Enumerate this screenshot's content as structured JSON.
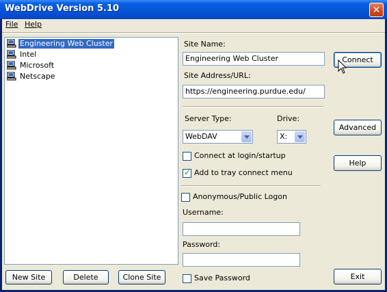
{
  "window": {
    "title": "WebDrive Version 5.10",
    "close_glyph": "✕"
  },
  "menu": {
    "file_label": "File",
    "help_label": "Help"
  },
  "sites": [
    {
      "label": "Engineering Web Cluster",
      "selected": true
    },
    {
      "label": "Intel"
    },
    {
      "label": "Microsoft"
    },
    {
      "label": "Netscape"
    }
  ],
  "list_buttons": {
    "new_site": "New Site",
    "delete": "Delete",
    "clone_site": "Clone Site"
  },
  "form": {
    "site_name_label": "Site Name:",
    "site_name_value": "Engineering Web Cluster",
    "site_address_label": "Site Address/URL:",
    "site_address_value": "https://engineering.purdue.edu/",
    "server_type_label": "Server Type:",
    "server_type_value": "WebDAV",
    "drive_label": "Drive:",
    "drive_value": "X:",
    "connect_at_login_label": "Connect at login/startup",
    "connect_at_login_checked": false,
    "add_to_tray_label": "Add to tray connect menu",
    "add_to_tray_checked": true,
    "anonymous_label": "Anonymous/Public Logon",
    "anonymous_checked": false,
    "username_label": "Username:",
    "username_value": "",
    "password_label": "Password:",
    "password_value": "",
    "save_password_label": "Save Password",
    "save_password_checked": false
  },
  "side_buttons": {
    "connect": "Connect",
    "advanced": "Advanced",
    "help": "Help",
    "exit": "Exit"
  }
}
